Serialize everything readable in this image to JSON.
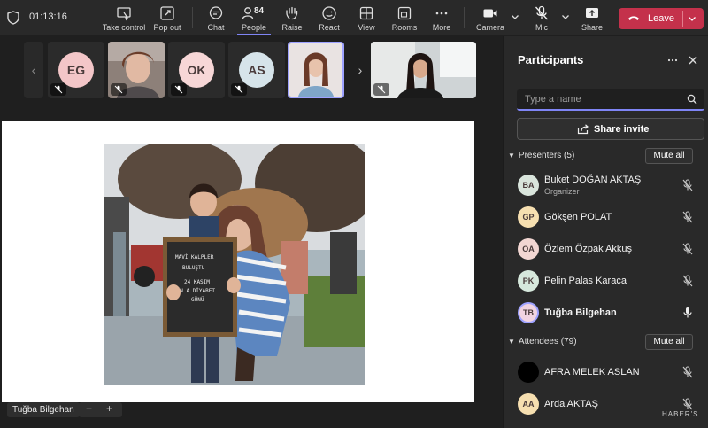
{
  "topbar": {
    "timer": "01:13:16",
    "take_control": "Take control",
    "pop_out": "Pop out",
    "chat": "Chat",
    "people": "People",
    "people_count": "84",
    "raise": "Raise",
    "react": "React",
    "view": "View",
    "rooms": "Rooms",
    "more": "More",
    "camera": "Camera",
    "mic": "Mic",
    "share": "Share",
    "leave": "Leave"
  },
  "strip": {
    "tiles": [
      {
        "initials": "EG",
        "color": "#f3c6c8"
      },
      {
        "initials": "",
        "color": "#a58f86"
      },
      {
        "initials": "OK",
        "color": "#f7d7d7"
      },
      {
        "initials": "AS",
        "color": "#d6e4ea"
      },
      {
        "initials": "",
        "color": "#b8a9a5"
      },
      {
        "initials": "",
        "color": "#5a5a5a"
      }
    ]
  },
  "stage": {
    "presenter_name": "Tuğba Bilgehan",
    "zoom_minus": "−",
    "zoom_plus": "+",
    "board_text": [
      "MAVİ KALPLER",
      "BULUŞTU",
      "24 KASIM",
      "DÜN A DİYABET",
      "GÜNÜ"
    ]
  },
  "panel": {
    "title": "Participants",
    "search_placeholder": "Type a name",
    "share_invite": "Share invite",
    "presenters_label": "Presenters (5)",
    "attendees_label": "Attendees (79)",
    "mute_all": "Mute all",
    "presenters": [
      {
        "initials": "BA",
        "name": "Buket DOĞAN AKTAŞ",
        "role": "Organizer",
        "color": "#d9e5dc",
        "mic": "muted"
      },
      {
        "initials": "GP",
        "name": "Gökşen POLAT",
        "role": "",
        "color": "#f6dfb0",
        "mic": "muted"
      },
      {
        "initials": "ÖA",
        "name": "Özlem Özpak Akkuş",
        "role": "",
        "color": "#f2d6d2",
        "mic": "muted"
      },
      {
        "initials": "PK",
        "name": "Pelin Palas Karaca",
        "role": "",
        "color": "#d6e8dc",
        "mic": "muted"
      },
      {
        "initials": "TB",
        "name": "Tuğba Bilgehan",
        "role": "",
        "color": "#f1d4e1",
        "mic": "on"
      }
    ],
    "attendees": [
      {
        "initials": "",
        "name": "AFRA MELEK ASLAN",
        "color": "#000000",
        "mic": "muted"
      },
      {
        "initials": "AA",
        "name": "Arda AKTAŞ",
        "color": "#f6dfb0",
        "mic": "muted"
      }
    ]
  },
  "watermark": "HABER'S"
}
